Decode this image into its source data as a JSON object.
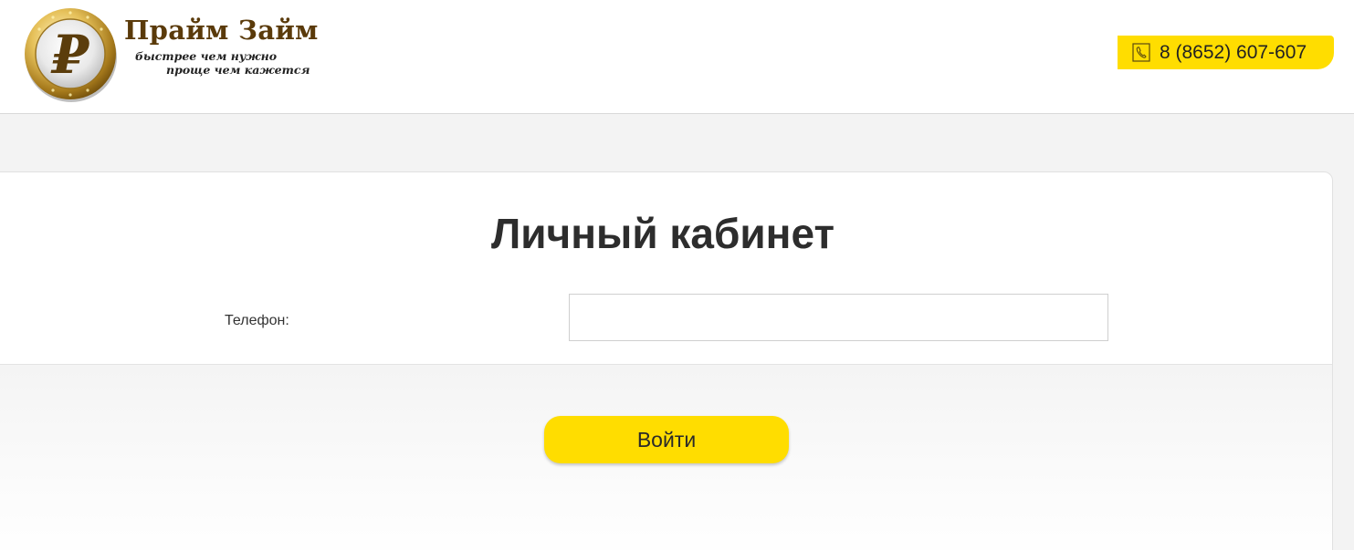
{
  "header": {
    "brand_name": "Прайм Займ",
    "slogan_line1": "быстрее чем нужно",
    "slogan_line2": "проще чем кажется",
    "logo_icon": "ruble-coin-icon",
    "phone_icon": "phone-icon",
    "phone_number": "8 (8652) 607-607",
    "accent_color": "#ffdd00"
  },
  "login_form": {
    "title": "Личный кабинет",
    "phone_label": "Телефон:",
    "phone_value": "",
    "submit_label": "Войти"
  }
}
